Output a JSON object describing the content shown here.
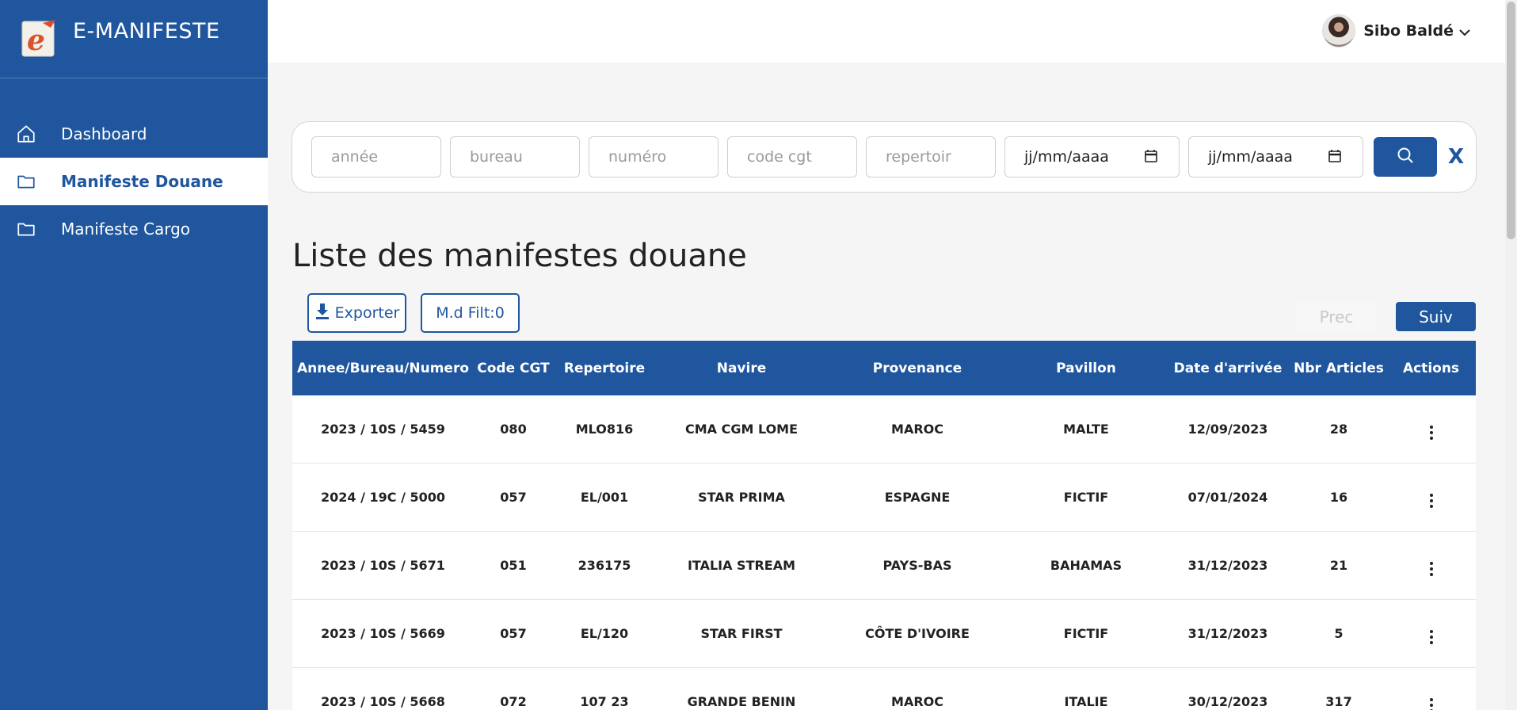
{
  "brand": {
    "title": "E-MANIFESTE",
    "logo_icon": "e-logo-icon"
  },
  "sidebar": {
    "items": [
      {
        "label": "Dashboard",
        "icon": "home-icon",
        "active": false
      },
      {
        "label": "Manifeste Douane",
        "icon": "folder-icon",
        "active": true
      },
      {
        "label": "Manifeste Cargo",
        "icon": "folder-icon",
        "active": false
      }
    ]
  },
  "header": {
    "user_name": "Sibo Baldé"
  },
  "filters": {
    "annee_placeholder": "année",
    "bureau_placeholder": "bureau",
    "numero_placeholder": "numéro",
    "code_cgt_placeholder": "code cgt",
    "repertoir_placeholder": "repertoir",
    "date_from": "jj/mm/aaaa",
    "date_to": "jj/mm/aaaa",
    "clear_label": "X"
  },
  "main": {
    "title": "Liste des manifestes douane",
    "export_label": "Exporter",
    "filter_label": "M.d Filt:0",
    "prev_label": "Prec",
    "next_label": "Suiv"
  },
  "table": {
    "headers": [
      "Annee/Bureau/Numero",
      "Code CGT",
      "Repertoire",
      "Navire",
      "Provenance",
      "Pavillon",
      "Date d'arrivée",
      "Nbr Articles",
      "Actions"
    ],
    "rows": [
      [
        "2023 / 10S / 5459",
        "080",
        "MLO816",
        "CMA CGM LOME",
        "MAROC",
        "MALTE",
        "12/09/2023",
        "28"
      ],
      [
        "2024 / 19C / 5000",
        "057",
        "EL/001",
        "STAR PRIMA",
        "ESPAGNE",
        "FICTIF",
        "07/01/2024",
        "16"
      ],
      [
        "2023 / 10S / 5671",
        "051",
        "236175",
        "ITALIA STREAM",
        "PAYS-BAS",
        "BAHAMAS",
        "31/12/2023",
        "21"
      ],
      [
        "2023 / 10S / 5669",
        "057",
        "EL/120",
        "STAR FIRST",
        "CÔTE D'IVOIRE",
        "FICTIF",
        "31/12/2023",
        "5"
      ],
      [
        "2023 / 10S / 5668",
        "072",
        "107 23",
        "GRANDE BENIN",
        "MAROC",
        "ITALIE",
        "30/12/2023",
        "317"
      ]
    ]
  },
  "colors": {
    "primary": "#1f569e",
    "background": "#f5f5f5"
  }
}
